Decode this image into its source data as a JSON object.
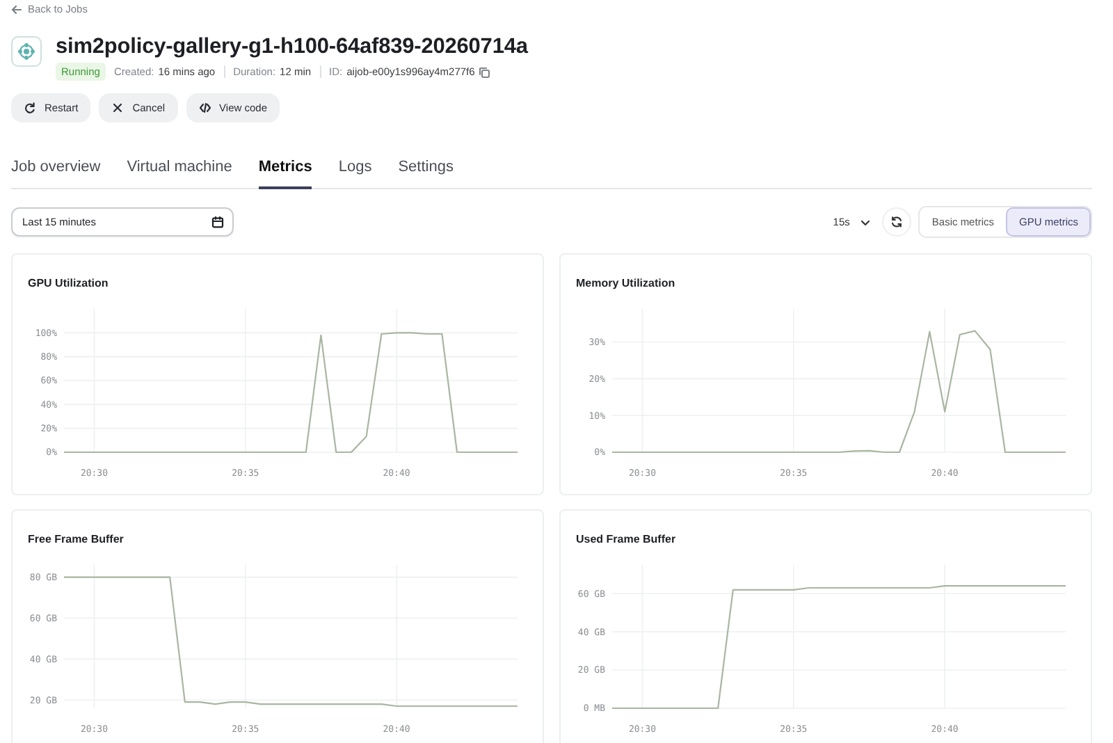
{
  "back_link": "Back to Jobs",
  "job": {
    "title": "sim2policy-gallery-g1-h100-64af839-20260714a",
    "status": "Running",
    "created_label": "Created:",
    "created": "16 mins ago",
    "duration_label": "Duration:",
    "duration": "12 min",
    "id_label": "ID:",
    "id": "aijob-e00y1s996ay4m277f6"
  },
  "actions": [
    {
      "label": "Restart"
    },
    {
      "label": "Cancel"
    },
    {
      "label": "View code"
    }
  ],
  "tabs": [
    {
      "label": "Job overview",
      "selected": false
    },
    {
      "label": "Virtual machine",
      "selected": false
    },
    {
      "label": "Metrics",
      "selected": true
    },
    {
      "label": "Logs",
      "selected": false
    },
    {
      "label": "Settings",
      "selected": false
    }
  ],
  "toolbar": {
    "time_range": {
      "value": "Last 15 minutes"
    },
    "interval": "15s",
    "views": [
      {
        "label": "Basic metrics",
        "selected": false
      },
      {
        "label": "GPU metrics",
        "selected": true
      }
    ]
  },
  "charts": [
    {
      "title": "GPU Utilization",
      "chart_data": {
        "type": "line",
        "categories": [
          null,
          null,
          "20:30",
          null,
          null,
          null,
          null,
          null,
          null,
          null,
          null,
          null,
          "20:35",
          null,
          null,
          null,
          null,
          null,
          null,
          null,
          null,
          null,
          "20:40",
          null,
          null,
          null,
          null,
          null,
          null,
          null,
          null
        ],
        "series": [
          {
            "color": "#a9b6a2",
            "values": [
              0,
              0,
              0,
              0,
              0,
              0,
              0,
              0,
              0,
              0,
              0,
              0,
              0,
              0,
              0,
              0,
              0,
              98,
              0,
              0,
              13,
              99,
              100,
              100,
              99,
              99,
              0,
              0,
              0,
              0,
              0
            ]
          }
        ],
        "grid": true,
        "ylim": [
          0,
          120
        ],
        "yticks": [
          {
            "value": 0,
            "label": "0%"
          },
          {
            "value": 20,
            "label": "20%"
          },
          {
            "value": 40,
            "label": "40%"
          },
          {
            "value": 60,
            "label": "60%"
          },
          {
            "value": 80,
            "label": "80%"
          },
          {
            "value": 100,
            "label": "100%"
          }
        ]
      }
    },
    {
      "title": "Memory Utilization",
      "chart_data": {
        "type": "line",
        "categories": [
          null,
          null,
          "20:30",
          null,
          null,
          null,
          null,
          null,
          null,
          null,
          null,
          null,
          "20:35",
          null,
          null,
          null,
          null,
          null,
          null,
          null,
          null,
          null,
          "20:40",
          null,
          null,
          null,
          null,
          null,
          null,
          null,
          null
        ],
        "series": [
          {
            "color": "#a9b6a2",
            "values": [
              0,
              0,
              0,
              0,
              0,
              0,
              0,
              0,
              0,
              0,
              0,
              0,
              0,
              0,
              0,
              0,
              0.3,
              0.4,
              0,
              0,
              11,
              32.8,
              11,
              32,
              33,
              28,
              0,
              0,
              0,
              0,
              0
            ]
          }
        ],
        "grid": true,
        "ylim": [
          0,
          39
        ],
        "yticks": [
          {
            "value": 0,
            "label": "0%"
          },
          {
            "value": 10,
            "label": "10%"
          },
          {
            "value": 20,
            "label": "20%"
          },
          {
            "value": 30,
            "label": "30%"
          }
        ]
      }
    },
    {
      "title": "Free Frame Buffer",
      "chart_data": {
        "type": "line",
        "categories": [
          null,
          null,
          "20:30",
          null,
          null,
          null,
          null,
          null,
          null,
          null,
          null,
          null,
          "20:35",
          null,
          null,
          null,
          null,
          null,
          null,
          null,
          null,
          null,
          "20:40",
          null,
          null,
          null,
          null,
          null,
          null,
          null,
          null
        ],
        "series": [
          {
            "color": "#a9b6a2",
            "values": [
              80,
              80,
              80,
              80,
              80,
              80,
              80,
              80,
              19,
              19,
              18,
              19,
              19,
              18,
              18,
              18,
              18,
              18,
              18,
              18,
              18,
              18,
              17,
              17,
              17,
              17,
              17,
              17,
              17,
              17,
              17
            ]
          }
        ],
        "grid": true,
        "ylim": [
          16,
          86
        ],
        "yticks": [
          {
            "value": 20,
            "label": "20 GB"
          },
          {
            "value": 40,
            "label": "40 GB"
          },
          {
            "value": 60,
            "label": "60 GB"
          },
          {
            "value": 80,
            "label": "80 GB"
          }
        ]
      }
    },
    {
      "title": "Used Frame Buffer",
      "chart_data": {
        "type": "line",
        "categories": [
          null,
          null,
          "20:30",
          null,
          null,
          null,
          null,
          null,
          null,
          null,
          null,
          null,
          "20:35",
          null,
          null,
          null,
          null,
          null,
          null,
          null,
          null,
          null,
          "20:40",
          null,
          null,
          null,
          null,
          null,
          null,
          null,
          null
        ],
        "series": [
          {
            "color": "#a9b6a2",
            "values": [
              0,
              0,
              0,
              0,
              0,
              0,
              0,
              0,
              62,
              62,
              62,
              62,
              62,
              63,
              63,
              63,
              63,
              63,
              63,
              63,
              63,
              63,
              64,
              64,
              64,
              64,
              64,
              64,
              64,
              64,
              64
            ]
          }
        ],
        "grid": true,
        "ylim": [
          0,
          75
        ],
        "yticks": [
          {
            "value": 0,
            "label": "0 MB"
          },
          {
            "value": 20,
            "label": "20 GB"
          },
          {
            "value": 40,
            "label": "40 GB"
          },
          {
            "value": 60,
            "label": "60 GB"
          }
        ]
      }
    }
  ]
}
